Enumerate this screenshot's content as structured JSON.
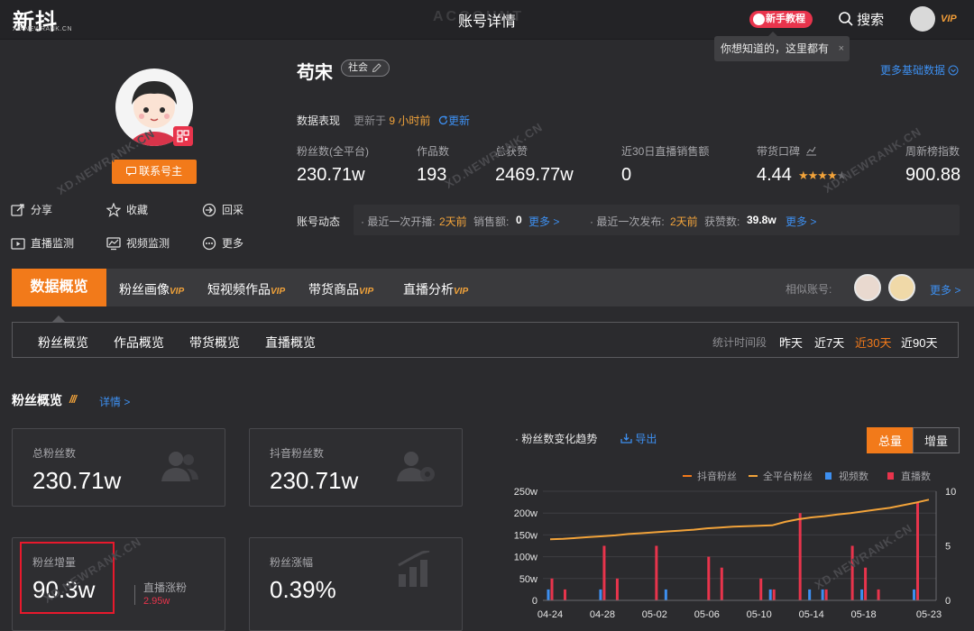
{
  "topbar": {
    "logo": "新抖",
    "logo_sub": "XD.NEWRANK.CN",
    "title": "账号详情",
    "title_ghost": "ACCOUNT",
    "tutorial": "新手教程",
    "search": "搜索",
    "vip": "VIP",
    "tooltip": "你想知道的，这里都有",
    "tooltip_close": "×"
  },
  "profile": {
    "contact": "联系号主",
    "actions": [
      "分享",
      "收藏",
      "回采",
      "直播监测",
      "视频监测",
      "更多"
    ],
    "name": "苟宋",
    "tag": "社会",
    "more_basic": "更多基础数据",
    "data_label": "数据表现",
    "update_prefix": "更新于",
    "update_time": "9 小时前",
    "update_link": "更新",
    "stats": [
      {
        "label": "粉丝数(全平台)",
        "value": "230.71w"
      },
      {
        "label": "作品数",
        "value": "193"
      },
      {
        "label": "总获赞",
        "value": "2469.77w"
      },
      {
        "label": "近30日直播销售额",
        "value": "0"
      },
      {
        "label": "带货口碑",
        "value": "4.44"
      },
      {
        "label": "周新榜指数",
        "value": "900.88"
      }
    ],
    "rating_stars": 4.44,
    "dynamic_label": "账号动态",
    "dynamic": {
      "live_prefix": "· 最近一次开播:",
      "live_time": "2天前",
      "sales_label": "销售额:",
      "sales_value": "0",
      "more1": "更多 >",
      "post_prefix": "· 最近一次发布:",
      "post_time": "2天前",
      "likes_label": "获赞数:",
      "likes_value": "39.8w",
      "more2": "更多 >"
    }
  },
  "tabs": {
    "active": "数据概览",
    "items": [
      "粉丝画像",
      "短视频作品",
      "带货商品",
      "直播分析"
    ],
    "vip": "VIP",
    "similar": "相似账号:",
    "more": "更多 >"
  },
  "subtabs": {
    "items": [
      "粉丝概览",
      "作品概览",
      "带货概览",
      "直播概览"
    ],
    "time_label": "统计时间段",
    "time_options": [
      "昨天",
      "近7天",
      "近30天",
      "近90天"
    ],
    "time_active": "近30天"
  },
  "overview": {
    "title": "粉丝概览",
    "detail": "详情 >",
    "cards": [
      {
        "label": "总粉丝数",
        "value": "230.71w"
      },
      {
        "label": "抖音粉丝数",
        "value": "230.71w"
      },
      {
        "label": "粉丝增量",
        "value": "90.3w"
      },
      {
        "label": "粉丝涨幅",
        "value": "0.39%"
      }
    ],
    "live_gain_label": "直播涨粉",
    "live_gain_value": "2.95w"
  },
  "watermark": "XD.NEWRANK.CN",
  "colors": {
    "accent": "#f27a1a",
    "blue": "#3d8ff0",
    "red": "#e8344c",
    "bg": "#2b2b2e"
  },
  "chart_data": {
    "type": "line",
    "title": "粉丝数变化趋势",
    "export": "导出",
    "toggle": [
      "总量",
      "增量"
    ],
    "toggle_active": "总量",
    "legend": [
      "抖音粉丝",
      "全平台粉丝",
      "视频数",
      "直播数"
    ],
    "legend_colors": [
      "#f27a1a",
      "#f2a33a",
      "#3d8ff0",
      "#e8344c"
    ],
    "x_ticks": [
      "04-24",
      "04-28",
      "05-02",
      "05-06",
      "05-10",
      "05-14",
      "05-18",
      "05-23"
    ],
    "y_left_ticks": [
      "0",
      "50w",
      "100w",
      "150w",
      "200w",
      "250w"
    ],
    "y_left_range": [
      0,
      250
    ],
    "y_right_ticks": [
      "0",
      "5",
      "10"
    ],
    "y_right_range": [
      0,
      10
    ],
    "x": [
      "04-24",
      "04-25",
      "04-26",
      "04-27",
      "04-28",
      "04-29",
      "04-30",
      "05-01",
      "05-02",
      "05-03",
      "05-04",
      "05-05",
      "05-06",
      "05-07",
      "05-08",
      "05-09",
      "05-10",
      "05-11",
      "05-12",
      "05-13",
      "05-14",
      "05-15",
      "05-16",
      "05-17",
      "05-18",
      "05-19",
      "05-20",
      "05-21",
      "05-22",
      "05-23"
    ],
    "fans_total": [
      140,
      141,
      143,
      145,
      147,
      149,
      152,
      154,
      156,
      158,
      160,
      162,
      165,
      167,
      169,
      170,
      171,
      172,
      180,
      186,
      190,
      193,
      197,
      200,
      204,
      208,
      212,
      218,
      224,
      230.71
    ],
    "video_counts": [
      1,
      0,
      0,
      0,
      1,
      0,
      0,
      0,
      0,
      1,
      0,
      0,
      0,
      0,
      0,
      0,
      0,
      1,
      0,
      0,
      1,
      1,
      0,
      0,
      1,
      0,
      0,
      0,
      1,
      0
    ],
    "live_counts": [
      2,
      1,
      0,
      0,
      5,
      2,
      0,
      0,
      5,
      0,
      0,
      0,
      4,
      3,
      0,
      0,
      2,
      1,
      0,
      8,
      0,
      1,
      0,
      5,
      3,
      1,
      0,
      0,
      9,
      0
    ]
  }
}
